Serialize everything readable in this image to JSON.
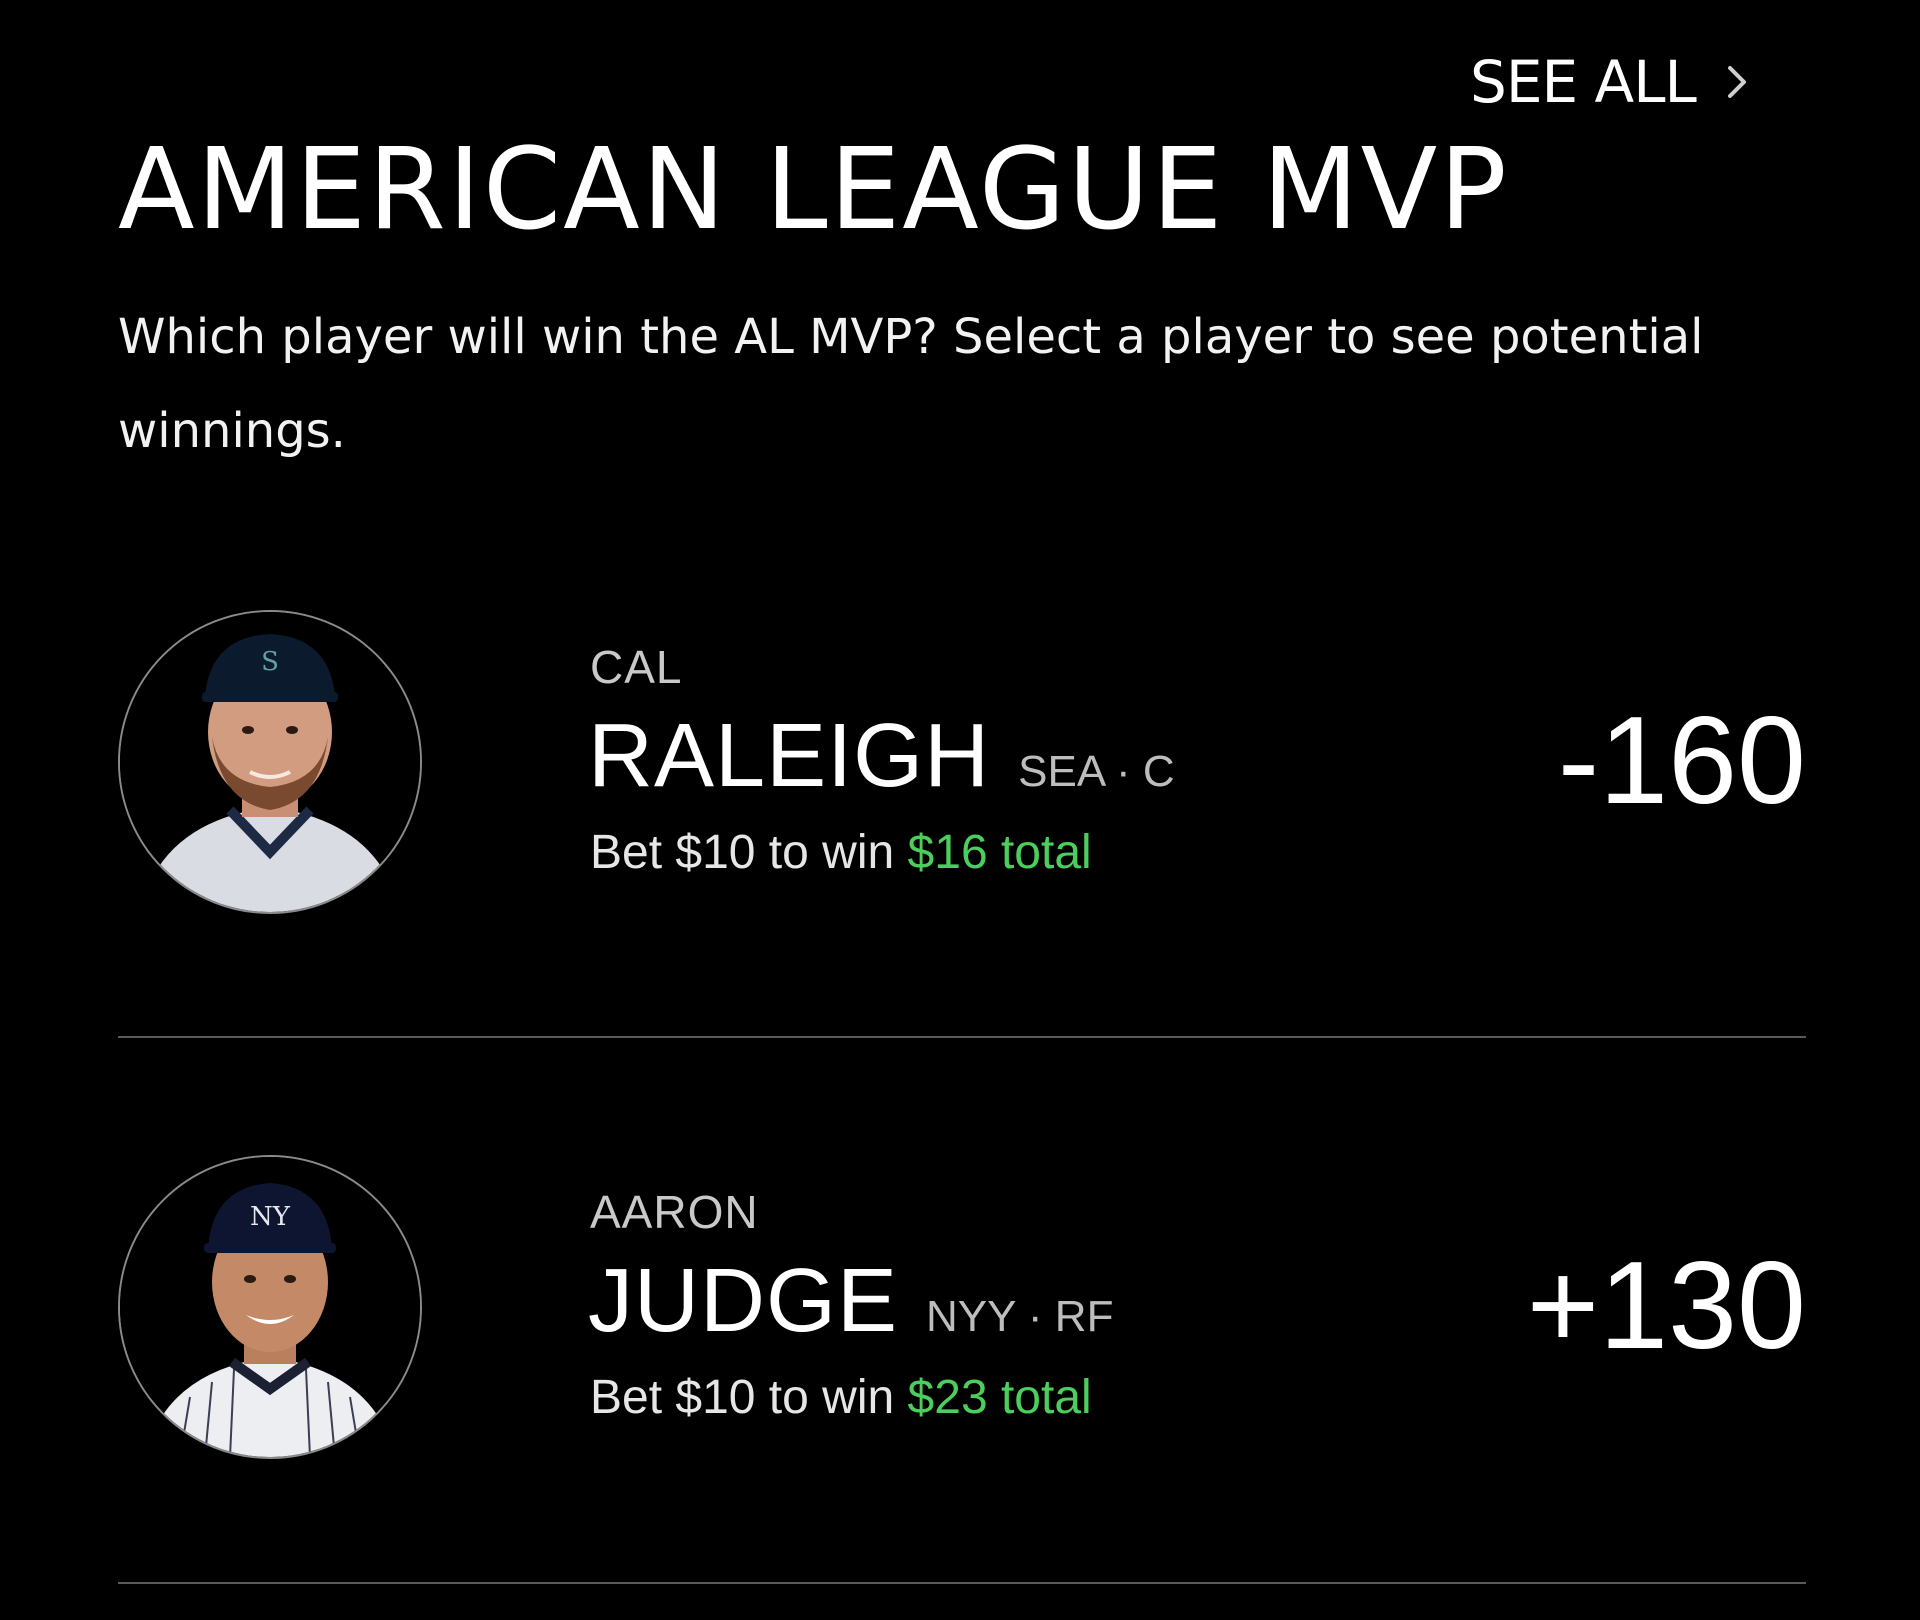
{
  "header": {
    "see_all_label": "SEE ALL",
    "see_all_icon": "chevron-right-icon",
    "title": "AMERICAN LEAGUE MVP",
    "subtitle": "Which player will win the AL MVP? Select a player to see potential winnings."
  },
  "players": [
    {
      "first_name": "CAL",
      "last_name": "RALEIGH",
      "team_position": "SEA · C",
      "bet_prefix": "Bet $10 to win",
      "bet_win": "$16 total",
      "odds": "-160",
      "avatar": "player-headshot"
    },
    {
      "first_name": "AARON",
      "last_name": "JUDGE",
      "team_position": "NYY · RF",
      "bet_prefix": "Bet $10 to win",
      "bet_win": "$23 total",
      "odds": "+130",
      "avatar": "player-headshot"
    }
  ],
  "colors": {
    "background": "#000000",
    "text": "#ffffff",
    "muted": "#bdbdbd",
    "win_accent": "#4cce5d",
    "divider": "#5a5a5a"
  }
}
